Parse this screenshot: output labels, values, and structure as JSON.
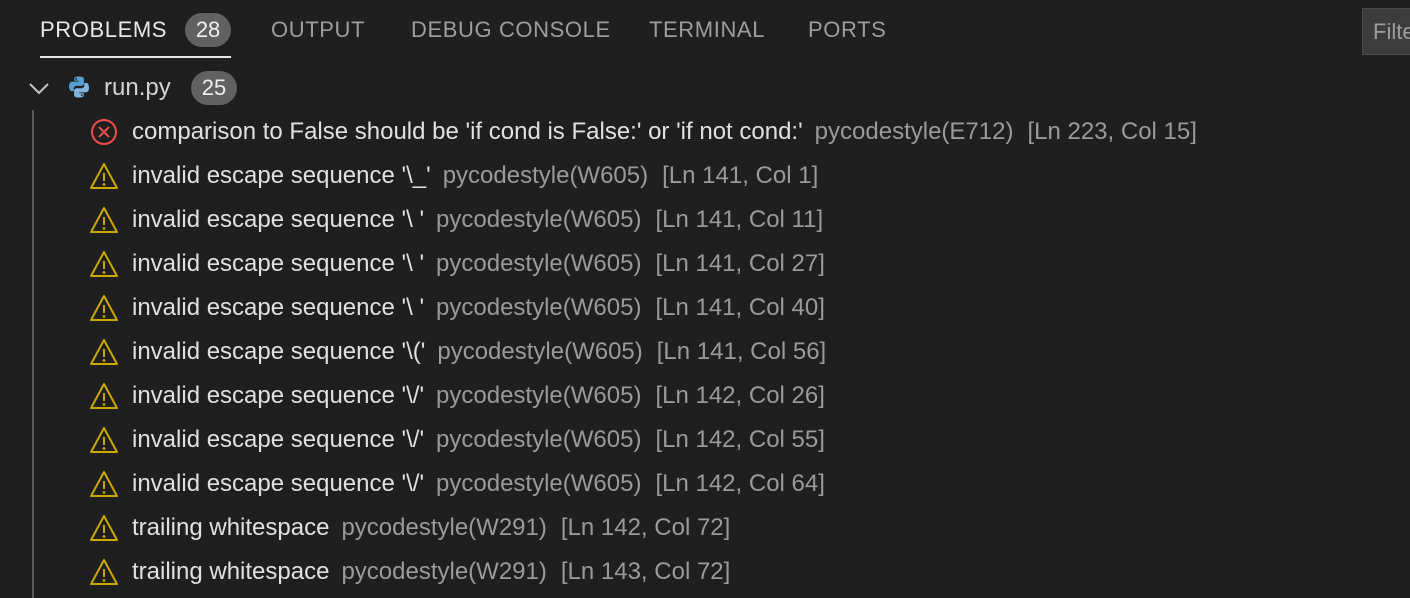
{
  "tabs": [
    {
      "label": "PROBLEMS",
      "badge": "28",
      "active": true
    },
    {
      "label": "OUTPUT"
    },
    {
      "label": "DEBUG CONSOLE"
    },
    {
      "label": "TERMINAL"
    },
    {
      "label": "PORTS"
    }
  ],
  "filter": {
    "text": "Filte"
  },
  "file": {
    "name": "run.py",
    "count": "25",
    "icon": "python-icon",
    "expanded": true
  },
  "colors": {
    "error": "#f14c4c",
    "warning": "#cca700"
  },
  "problems": [
    {
      "severity": "error",
      "icon": "error-circle-icon",
      "message": "comparison to False should be 'if cond is False:' or 'if not cond:'",
      "source": "pycodestyle(E712)",
      "location": "[Ln 223, Col 15]"
    },
    {
      "severity": "warning",
      "icon": "warning-triangle-icon",
      "message": "invalid escape sequence '\\_'",
      "source": "pycodestyle(W605)",
      "location": "[Ln 141, Col 1]"
    },
    {
      "severity": "warning",
      "icon": "warning-triangle-icon",
      "message": "invalid escape sequence '\\ '",
      "source": "pycodestyle(W605)",
      "location": "[Ln 141, Col 11]"
    },
    {
      "severity": "warning",
      "icon": "warning-triangle-icon",
      "message": "invalid escape sequence '\\ '",
      "source": "pycodestyle(W605)",
      "location": "[Ln 141, Col 27]"
    },
    {
      "severity": "warning",
      "icon": "warning-triangle-icon",
      "message": "invalid escape sequence '\\ '",
      "source": "pycodestyle(W605)",
      "location": "[Ln 141, Col 40]"
    },
    {
      "severity": "warning",
      "icon": "warning-triangle-icon",
      "message": "invalid escape sequence '\\('",
      "source": "pycodestyle(W605)",
      "location": "[Ln 141, Col 56]"
    },
    {
      "severity": "warning",
      "icon": "warning-triangle-icon",
      "message": "invalid escape sequence '\\/'",
      "source": "pycodestyle(W605)",
      "location": "[Ln 142, Col 26]"
    },
    {
      "severity": "warning",
      "icon": "warning-triangle-icon",
      "message": "invalid escape sequence '\\/'",
      "source": "pycodestyle(W605)",
      "location": "[Ln 142, Col 55]"
    },
    {
      "severity": "warning",
      "icon": "warning-triangle-icon",
      "message": "invalid escape sequence '\\/'",
      "source": "pycodestyle(W605)",
      "location": "[Ln 142, Col 64]"
    },
    {
      "severity": "warning",
      "icon": "warning-triangle-icon",
      "message": "trailing whitespace",
      "source": "pycodestyle(W291)",
      "location": "[Ln 142, Col 72]"
    },
    {
      "severity": "warning",
      "icon": "warning-triangle-icon",
      "message": "trailing whitespace",
      "source": "pycodestyle(W291)",
      "location": "[Ln 143, Col 72]"
    }
  ]
}
